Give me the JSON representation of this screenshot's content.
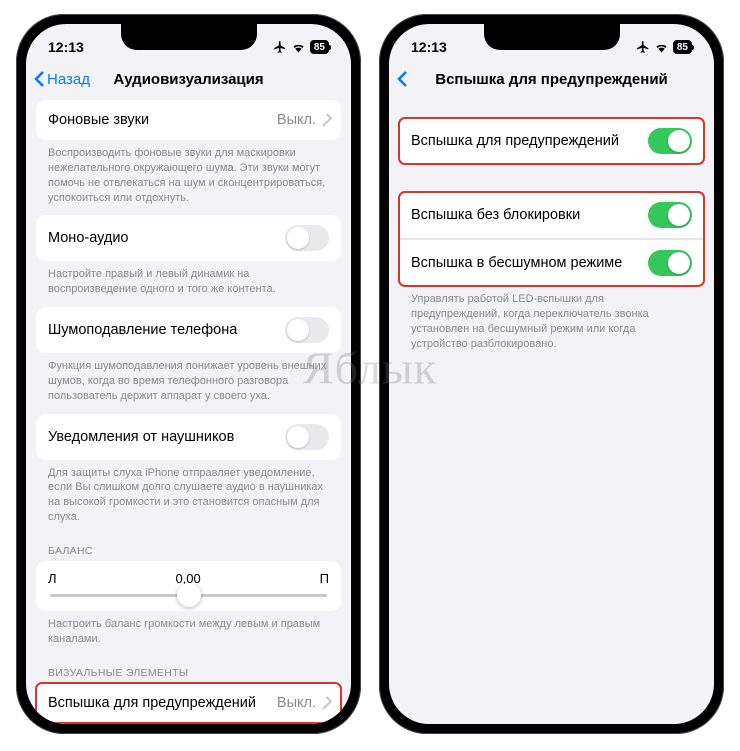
{
  "status": {
    "time": "12:13",
    "battery": "85"
  },
  "watermark": "Яблык",
  "left": {
    "back": "Назад",
    "title": "Аудиовизуализация",
    "bgSounds": {
      "label": "Фоновые звуки",
      "value": "Выкл."
    },
    "bgSoundsFooter": "Воспроизводить фоновые звуки для маскировки нежелательного окружающего шума. Эти звуки могут помочь не отвлекаться на шум и сконцентрироваться, успокоиться или отдохнуть.",
    "mono": {
      "label": "Моно-аудио"
    },
    "monoFooter": "Настройте правый и левый динамик на воспроизведение одного и того же контента.",
    "noise": {
      "label": "Шумоподавление телефона"
    },
    "noiseFooter": "Функция шумоподавления понижает уровень внешних шумов, когда во время телефонного разговора пользователь держит аппарат у своего уха.",
    "headphone": {
      "label": "Уведомления от наушников"
    },
    "headphoneFooter": "Для защиты слуха iPhone отправляет уведомление, если Вы слишком долго слушаете аудио в наушниках на высокой громкости и это становится опасным для слуха.",
    "balanceHeader": "БАЛАНС",
    "balance": {
      "left": "Л",
      "center": "0,00",
      "right": "П"
    },
    "balanceFooter": "Настроить баланс громкости между левым и правым каналами.",
    "visualHeader": "ВИЗУАЛЬНЫЕ ЭЛЕМЕНТЫ",
    "flash": {
      "label": "Вспышка для предупреждений",
      "value": "Выкл."
    }
  },
  "right": {
    "title": "Вспышка для предупреждений",
    "main": {
      "label": "Вспышка для предупреждений"
    },
    "unlock": {
      "label": "Вспышка без блокировки"
    },
    "silent": {
      "label": "Вспышка в бесшумном режиме"
    },
    "footer": "Управлять работой LED-вспышки для предупреждений, когда переключатель звонка установлен на бесшумный режим или когда устройство разблокировано."
  }
}
